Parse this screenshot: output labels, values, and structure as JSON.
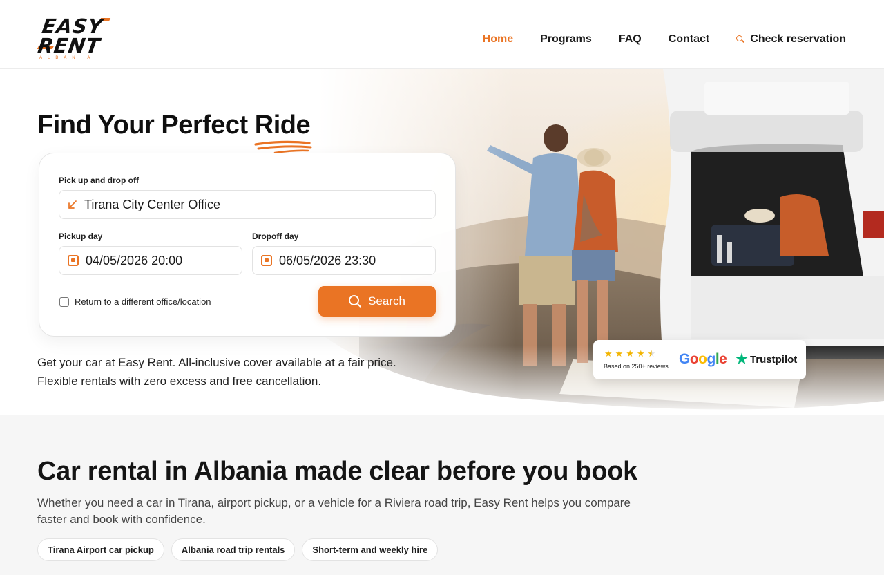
{
  "brand": {
    "logo_line1": "EASY",
    "logo_line2": "RENT",
    "logo_sub": "ALBANIA",
    "accent_color": "#ea7424"
  },
  "nav": {
    "home": "Home",
    "programs": "Programs",
    "faq": "FAQ",
    "contact": "Contact",
    "check_reservation": "Check reservation",
    "check_icon": "search-icon"
  },
  "hero": {
    "title_main": "Find Your Perfect ",
    "title_highlight": "Ride",
    "description_line1": "Get your car at Easy Rent. All-inclusive cover available at a fair price.",
    "description_line2": "Flexible rentals with zero excess and free cancellation."
  },
  "booking": {
    "location_label": "Pick up and drop off",
    "location_value": "Tirana City Center Office",
    "location_icon": "arrow-down-left-icon",
    "pickup_label": "Pickup day",
    "pickup_value": "04/05/2026 20:00",
    "dropoff_label": "Dropoff day",
    "dropoff_value": "06/05/2026 23:30",
    "calendar_icon": "calendar-icon",
    "different_location_label": "Return to a different office/location",
    "different_location_checked": false,
    "search_label": "Search"
  },
  "reviews": {
    "rating_stars": 4.5,
    "based_on": "Based on 250+ reviews",
    "google_label": "Google",
    "trustpilot_label": "Trustpilot"
  },
  "section": {
    "title": "Car rental in Albania made clear before you book",
    "description": "Whether you need a car in Tirana, airport pickup, or a vehicle for a Riviera road trip, Easy Rent helps you compare faster and book with confidence.",
    "chips": [
      "Tirana Airport car pickup",
      "Albania road trip rentals",
      "Short-term and weekly hire"
    ]
  }
}
